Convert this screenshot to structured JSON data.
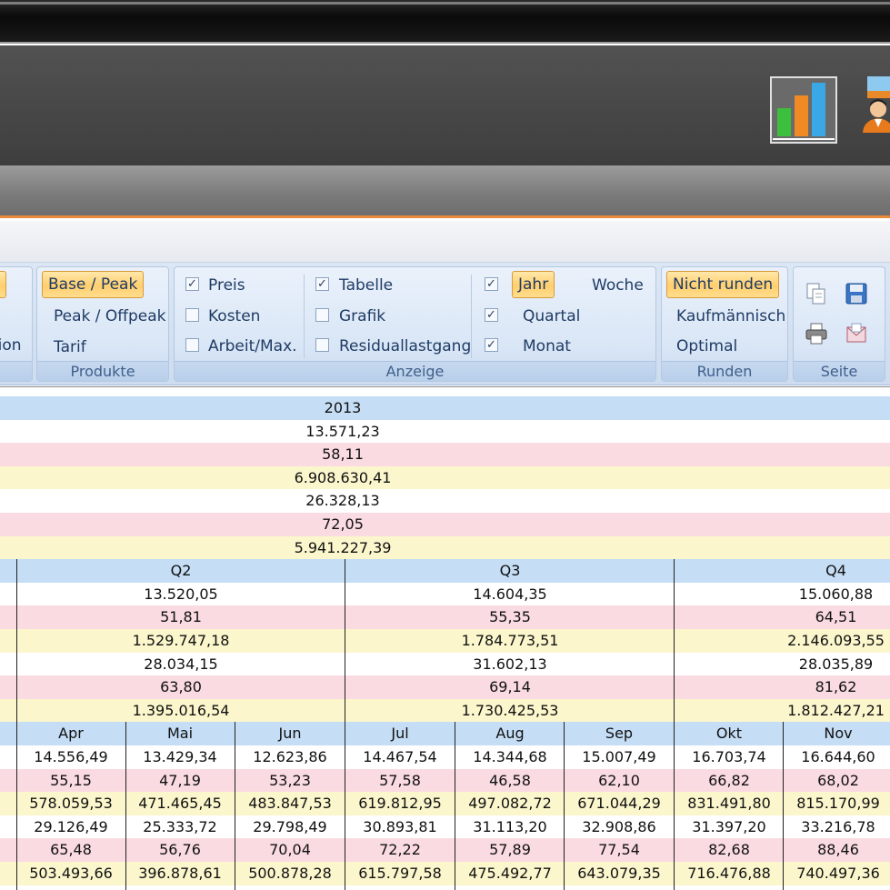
{
  "ribbon": {
    "groups": {
      "produkte": {
        "label": "Produkte",
        "items": [
          "Base / Peak",
          "Peak / Offpeak",
          "Tarif"
        ],
        "selected": "Base / Peak"
      },
      "anzeige": {
        "label": "Anzeige",
        "checks_col1": [
          {
            "label": "Preis",
            "checked": true
          },
          {
            "label": "Kosten",
            "checked": false
          },
          {
            "label": "Arbeit/Max.",
            "checked": false
          }
        ],
        "checks_col2": [
          {
            "label": "Tabelle",
            "checked": true
          },
          {
            "label": "Grafik",
            "checked": false
          },
          {
            "label": "Residuallastgang",
            "checked": false
          }
        ],
        "period_checks": [
          true,
          true,
          true
        ],
        "periods": [
          "Jahr",
          "Quartal",
          "Monat"
        ],
        "period_selected": "Jahr",
        "week": "Woche"
      },
      "runden": {
        "label": "Runden",
        "items": [
          "Nicht runden",
          "Kaufmännisch",
          "Optimal"
        ],
        "selected": "Nicht runden"
      },
      "seite": {
        "label": "Seite"
      }
    },
    "left_partial_label": "tion"
  },
  "table": {
    "year": {
      "label": "2013",
      "values": [
        "13.571,23",
        "58,11",
        "6.908.630,41",
        "26.328,13",
        "72,05",
        "5.941.227,39"
      ]
    },
    "quarters": [
      {
        "label": "Q2",
        "values": [
          "13.520,05",
          "51,81",
          "1.529.747,18",
          "28.034,15",
          "63,80",
          "1.395.016,54"
        ]
      },
      {
        "label": "Q3",
        "values": [
          "14.604,35",
          "55,35",
          "1.784.773,51",
          "31.602,13",
          "69,14",
          "1.730.425,53"
        ]
      },
      {
        "label": "Q4",
        "values": [
          "15.060,88",
          "64,51",
          "2.146.093,55",
          "28.035,89",
          "81,62",
          "1.812.427,21"
        ]
      }
    ],
    "months": [
      {
        "label": "Apr",
        "values": [
          "14.556,49",
          "55,15",
          "578.059,53",
          "29.126,49",
          "65,48",
          "503.493,66"
        ]
      },
      {
        "label": "Mai",
        "values": [
          "13.429,34",
          "47,19",
          "471.465,45",
          "25.333,72",
          "56,76",
          "396.878,61"
        ]
      },
      {
        "label": "Jun",
        "values": [
          "12.623,86",
          "53,23",
          "483.847,53",
          "29.798,49",
          "70,04",
          "500.878,28"
        ]
      },
      {
        "label": "Jul",
        "values": [
          "14.467,54",
          "57,58",
          "619.812,95",
          "30.893,81",
          "72,22",
          "615.797,58"
        ]
      },
      {
        "label": "Aug",
        "values": [
          "14.344,68",
          "46,58",
          "497.082,72",
          "31.113,20",
          "57,89",
          "475.492,77"
        ]
      },
      {
        "label": "Sep",
        "values": [
          "15.007,49",
          "62,10",
          "671.044,29",
          "32.908,86",
          "77,54",
          "643.079,35"
        ]
      },
      {
        "label": "Okt",
        "values": [
          "16.703,74",
          "66,82",
          "831.491,80",
          "31.397,20",
          "82,68",
          "716.476,88"
        ]
      },
      {
        "label": "Nov",
        "values": [
          "16.644,60",
          "68,02",
          "815.170,99",
          "33.216,78",
          "88,46",
          "740.497,36"
        ]
      }
    ],
    "row_styles": [
      "r-white",
      "r-pink",
      "r-yellow",
      "r-white",
      "r-pink",
      "r-yellow"
    ]
  },
  "colors": {
    "accent_orange": "#e98a3a",
    "header_blue": "#c5ddf5",
    "row_pink": "#fadbe1",
    "row_yellow": "#fbf6cc"
  },
  "icons": [
    "bar-chart-icon",
    "user-icon",
    "copy-icon",
    "save-icon",
    "print-icon",
    "email-icon",
    "dialog-launcher-icon"
  ]
}
